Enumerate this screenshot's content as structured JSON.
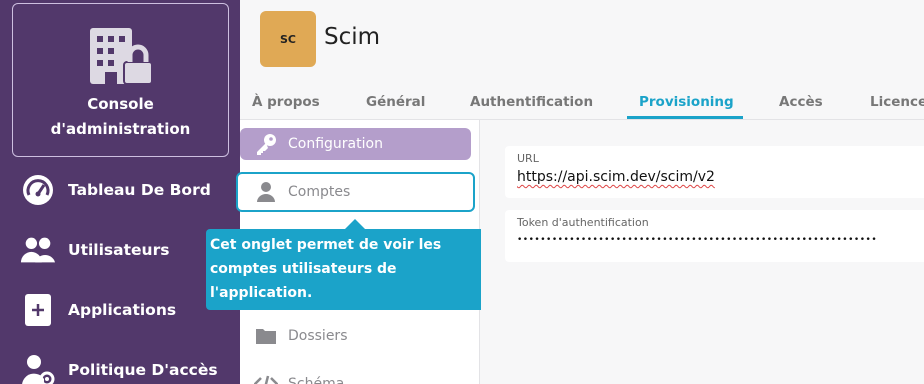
{
  "sidebar": {
    "console_title_line1": "Console",
    "console_title_line2": "d'administration",
    "items": [
      {
        "label": "Tableau De Bord",
        "icon": "dashboard-gauge-icon"
      },
      {
        "label": "Utilisateurs",
        "icon": "users-icon"
      },
      {
        "label": "Applications",
        "icon": "applications-plus-icon"
      },
      {
        "label": "Politique D'accès",
        "icon": "user-gear-icon"
      }
    ]
  },
  "header": {
    "app_logo_text": "SC",
    "app_name": "Scim",
    "tabs": [
      {
        "label": "À propos"
      },
      {
        "label": "Général"
      },
      {
        "label": "Authentification"
      },
      {
        "label": "Provisioning",
        "active": true
      },
      {
        "label": "Accès"
      },
      {
        "label": "Licence"
      }
    ]
  },
  "submenu": {
    "items": [
      {
        "label": "Configuration",
        "icon": "key-icon"
      },
      {
        "label": "Comptes",
        "icon": "user-icon"
      },
      {
        "label": "Dossiers",
        "icon": "folder-icon"
      },
      {
        "label": "Schéma",
        "icon": "code-icon"
      }
    ]
  },
  "tooltip": {
    "line1": "Cet onglet permet de voir les",
    "line2": "comptes utilisateurs de",
    "line3": "l'application."
  },
  "fields": {
    "url_label": "URL",
    "url_value": "https://api.scim.dev/scim/v2",
    "token_label": "Token d'authentification",
    "token_value": "••••••••••••••••••••••••••••••••••••••••••••••••••••••••••••••"
  },
  "colors": {
    "sidebar_bg": "#52386b",
    "accent": "#1ba3c9",
    "submenu_active": "#b49ecb",
    "app_logo_bg": "#e0a955"
  }
}
